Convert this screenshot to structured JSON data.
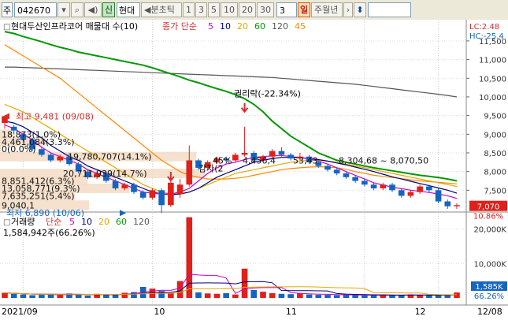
{
  "toolbar": {
    "market_label": "주",
    "code": "042670",
    "name": "현대",
    "period_prefix": "◀분초틱",
    "periods": [
      "1",
      "3",
      "5",
      "10",
      "20",
      "30"
    ],
    "selected_period": "3",
    "day_label": "일",
    "week_month_year": "주월년"
  },
  "price_panel": {
    "legend_title": "현대두산인프라코어 매물대 수(10)",
    "legend_ma_label": "종가 단순",
    "ma_periods": [
      "5",
      "10",
      "20",
      "60",
      "120",
      "45"
    ],
    "ma_colors": [
      "#cc00cc",
      "#000080",
      "#e6a700",
      "#009900",
      "#555555",
      "#ff8800"
    ],
    "lc_label": "LC:2.48",
    "hc_label": "HC:-25.4",
    "y_ticks": [
      11500,
      11000,
      10500,
      10000,
      9500,
      9000,
      8500,
      8000,
      7500
    ],
    "high_label": "최고 9,481 (09/08)",
    "low_label": "최저 6,890 (10/06)",
    "event_label_1": "권리락(-22.34%)",
    "event_label_2": "감자(2",
    "current_price": "7,070",
    "current_change": "10.86%"
  },
  "volume_profile": [
    {
      "label": "18,873(1.0%)",
      "price": 9000,
      "pct": 1.0
    },
    {
      "label": "4,461,084(3.3%)",
      "price": 8800,
      "pct": 3.3
    },
    {
      "label": "0(0.0%)",
      "price": 8600,
      "pct": 0.0
    },
    {
      "label": "19,780,707(14.1%)",
      "price": 8400,
      "pct": 14.1
    },
    {
      "label": "20,711,939(14.7%)",
      "price": 7950,
      "pct": 14.7
    },
    {
      "label": "8,851,412(6.3%)",
      "price": 7750,
      "pct": 6.3
    },
    {
      "label": "13,058,771(9.3%)",
      "price": 7550,
      "pct": 9.3
    },
    {
      "label": "7,635,251(5.4%)",
      "price": 7350,
      "pct": 5.4
    },
    {
      "label": "9,040,1",
      "price": 7100,
      "pct": 6.4
    }
  ],
  "profile_overlay_labels": [
    "45%",
    "4,456,4",
    "53,43",
    "8,304,68 ~ 8,070,50"
  ],
  "volume_panel": {
    "legend_title": "거래량",
    "legend_ma_label": "단순",
    "ma_periods": [
      "5",
      "10",
      "20",
      "60",
      "120"
    ],
    "ma_colors": [
      "#cc00cc",
      "#000080",
      "#e6a700",
      "#009900",
      "#555555"
    ],
    "max_label": "1,584,942주(66.26%)",
    "y_ticks": [
      "20,000K",
      "10,000K"
    ],
    "current_volume": "1,585K",
    "current_pct": "66.26%"
  },
  "x_axis": {
    "labels": [
      "2021/09",
      "10",
      "11",
      "12",
      "12/08"
    ]
  },
  "chart_data": {
    "type": "candlestick",
    "title": "현대두산인프라코어 매물대 수(10)",
    "y_range": [
      7000,
      11900
    ],
    "candles": [
      {
        "o": 9300,
        "c": 9481,
        "h": 9481,
        "l": 9150
      },
      {
        "o": 9200,
        "c": 9100,
        "h": 9250,
        "l": 9000
      },
      {
        "o": 9000,
        "c": 8850,
        "h": 9050,
        "l": 8800
      },
      {
        "o": 8850,
        "c": 8600,
        "h": 8900,
        "l": 8550
      },
      {
        "o": 8600,
        "c": 8450,
        "h": 8650,
        "l": 8400
      },
      {
        "o": 8450,
        "c": 8300,
        "h": 8500,
        "l": 8250
      },
      {
        "o": 8300,
        "c": 8400,
        "h": 8450,
        "l": 8250
      },
      {
        "o": 8400,
        "c": 8200,
        "h": 8450,
        "l": 8150
      },
      {
        "o": 8200,
        "c": 8000,
        "h": 8250,
        "l": 7950
      },
      {
        "o": 8000,
        "c": 7850,
        "h": 8050,
        "l": 7800
      },
      {
        "o": 7850,
        "c": 7950,
        "h": 8000,
        "l": 7800
      },
      {
        "o": 7950,
        "c": 7750,
        "h": 8000,
        "l": 7700
      },
      {
        "o": 7750,
        "c": 7550,
        "h": 7800,
        "l": 7500
      },
      {
        "o": 7550,
        "c": 7650,
        "h": 7700,
        "l": 7500
      },
      {
        "o": 7650,
        "c": 7450,
        "h": 7700,
        "l": 7400
      },
      {
        "o": 7450,
        "c": 7300,
        "h": 7500,
        "l": 7250
      },
      {
        "o": 7300,
        "c": 7500,
        "h": 7550,
        "l": 7250
      },
      {
        "o": 7500,
        "c": 7100,
        "h": 7550,
        "l": 6890
      },
      {
        "o": 7100,
        "c": 7700,
        "h": 7750,
        "l": 7050
      },
      {
        "o": 7400,
        "c": 7650,
        "h": 7800,
        "l": 7300
      },
      {
        "o": 7650,
        "c": 8300,
        "h": 8700,
        "l": 7600
      },
      {
        "o": 8300,
        "c": 8100,
        "h": 8350,
        "l": 8050
      },
      {
        "o": 8100,
        "c": 8250,
        "h": 8300,
        "l": 8050
      },
      {
        "o": 8250,
        "c": 8350,
        "h": 8400,
        "l": 8200
      },
      {
        "o": 8350,
        "c": 8300,
        "h": 8400,
        "l": 8250
      },
      {
        "o": 8300,
        "c": 8450,
        "h": 8500,
        "l": 8250
      },
      {
        "o": 8450,
        "c": 8500,
        "h": 9200,
        "l": 8400
      },
      {
        "o": 8500,
        "c": 8300,
        "h": 8550,
        "l": 8250
      },
      {
        "o": 8300,
        "c": 8400,
        "h": 8450,
        "l": 8250
      },
      {
        "o": 8400,
        "c": 8550,
        "h": 8600,
        "l": 8350
      },
      {
        "o": 8550,
        "c": 8450,
        "h": 8650,
        "l": 8400
      },
      {
        "o": 8450,
        "c": 8350,
        "h": 8500,
        "l": 8300
      },
      {
        "o": 8350,
        "c": 8400,
        "h": 8500,
        "l": 8300
      },
      {
        "o": 8400,
        "c": 8250,
        "h": 8450,
        "l": 8200
      },
      {
        "o": 8250,
        "c": 8150,
        "h": 8300,
        "l": 8100
      },
      {
        "o": 8150,
        "c": 8050,
        "h": 8200,
        "l": 8000
      },
      {
        "o": 8050,
        "c": 7950,
        "h": 8100,
        "l": 7900
      },
      {
        "o": 7950,
        "c": 7850,
        "h": 8000,
        "l": 7800
      },
      {
        "o": 7850,
        "c": 7750,
        "h": 7900,
        "l": 7700
      },
      {
        "o": 7750,
        "c": 7650,
        "h": 7800,
        "l": 7600
      },
      {
        "o": 7650,
        "c": 7550,
        "h": 7700,
        "l": 7500
      },
      {
        "o": 7550,
        "c": 7650,
        "h": 7700,
        "l": 7500
      },
      {
        "o": 7650,
        "c": 7500,
        "h": 7700,
        "l": 7450
      },
      {
        "o": 7500,
        "c": 7350,
        "h": 7550,
        "l": 7300
      },
      {
        "o": 7350,
        "c": 7450,
        "h": 7500,
        "l": 7300
      },
      {
        "o": 7450,
        "c": 7600,
        "h": 7650,
        "l": 7400
      },
      {
        "o": 7600,
        "c": 7500,
        "h": 7650,
        "l": 7450
      },
      {
        "o": 7500,
        "c": 7200,
        "h": 7550,
        "l": 7150
      },
      {
        "o": 7200,
        "c": 7070,
        "h": 7250,
        "l": 7000
      },
      {
        "o": 7070,
        "c": 7100,
        "h": 7150,
        "l": 7000
      }
    ],
    "ma_series": [
      {
        "period": "120",
        "color": "#555555",
        "values": [
          10800,
          10800,
          10790,
          10780,
          10770,
          10760,
          10750,
          10740,
          10730,
          10720,
          10710,
          10700,
          10690,
          10680,
          10670,
          10660,
          10650,
          10640,
          10630,
          10620,
          10610,
          10600,
          10590,
          10580,
          10570,
          10560,
          10550,
          10540,
          10530,
          10520,
          10500,
          10480,
          10460,
          10440,
          10420,
          10400,
          10380,
          10360,
          10340,
          10310,
          10280,
          10250,
          10220,
          10190,
          10160,
          10130,
          10100,
          10070,
          10040,
          10000
        ]
      },
      {
        "period": "60",
        "color": "#009900",
        "values": [
          11750,
          11700,
          11620,
          11550,
          11480,
          11400,
          11330,
          11270,
          11200,
          11150,
          11100,
          11050,
          11000,
          10950,
          10900,
          10850,
          10780,
          10700,
          10620,
          10540,
          10450,
          10380,
          10300,
          10220,
          10150,
          10060,
          9950,
          9800,
          9600,
          9350,
          9150,
          8950,
          8800,
          8650,
          8500,
          8400,
          8300,
          8250,
          8200,
          8150,
          8100,
          8060,
          8020,
          7980,
          7940,
          7900,
          7870,
          7840,
          7800,
          7750
        ]
      },
      {
        "period": "45",
        "color": "#ff8800",
        "values": [
          11400,
          11250,
          11100,
          10950,
          10800,
          10650,
          10500,
          10300,
          10100,
          9900,
          9700,
          9500,
          9300,
          9100,
          8900,
          8700,
          8500,
          8300,
          8150,
          8000,
          7900,
          7850,
          7800,
          7800,
          7800,
          7820,
          7850,
          7900,
          7950,
          8000,
          8050,
          8080,
          8100,
          8120,
          8130,
          8120,
          8100,
          8060,
          8000,
          7950,
          7900,
          7870,
          7840,
          7810,
          7780,
          7750,
          7730,
          7710,
          7690,
          7670
        ]
      },
      {
        "period": "20",
        "color": "#e6a700",
        "values": [
          9800,
          9700,
          9600,
          9450,
          9300,
          9150,
          9000,
          8850,
          8700,
          8550,
          8400,
          8250,
          8100,
          7950,
          7800,
          7650,
          7550,
          7450,
          7400,
          7400,
          7450,
          7550,
          7650,
          7750,
          7850,
          7950,
          8000,
          8050,
          8100,
          8150,
          8200,
          8250,
          8280,
          8300,
          8300,
          8280,
          8250,
          8200,
          8150,
          8100,
          8050,
          8000,
          7950,
          7900,
          7850,
          7800,
          7750,
          7700,
          7650,
          7600
        ]
      },
      {
        "period": "10",
        "color": "#000080",
        "values": [
          9350,
          9300,
          9200,
          9050,
          8900,
          8700,
          8550,
          8400,
          8300,
          8150,
          8050,
          7950,
          7850,
          7750,
          7650,
          7550,
          7450,
          7400,
          7380,
          7400,
          7450,
          7550,
          7700,
          7850,
          7950,
          8050,
          8150,
          8250,
          8300,
          8350,
          8380,
          8380,
          8370,
          8350,
          8320,
          8280,
          8230,
          8180,
          8120,
          8060,
          8000,
          7930,
          7860,
          7800,
          7740,
          7680,
          7620,
          7560,
          7500,
          7420
        ]
      },
      {
        "period": "5",
        "color": "#cc00cc",
        "values": [
          9250,
          9150,
          9000,
          8850,
          8650,
          8500,
          8400,
          8300,
          8200,
          8050,
          7950,
          7850,
          7750,
          7650,
          7550,
          7450,
          7420,
          7400,
          7400,
          7450,
          7550,
          7750,
          7950,
          8100,
          8200,
          8250,
          8320,
          8380,
          8400,
          8420,
          8430,
          8400,
          8380,
          8350,
          8280,
          8200,
          8100,
          8000,
          7900,
          7800,
          7700,
          7640,
          7580,
          7540,
          7500,
          7470,
          7440,
          7400,
          7350,
          7280
        ]
      }
    ],
    "volumes_k": [
      1500,
      1200,
      1000,
      800,
      900,
      1100,
      800,
      1300,
      900,
      700,
      1200,
      900,
      1000,
      1500,
      1700,
      3200,
      2700,
      2000,
      1400,
      4900,
      23400,
      1600,
      1300,
      1200,
      1400,
      1000,
      8500,
      2300,
      1800,
      1400,
      1200,
      1100,
      1300,
      1000,
      900,
      900,
      800,
      900,
      800,
      700,
      800,
      900,
      700,
      900,
      1000,
      800,
      700,
      800,
      1000,
      1585
    ],
    "volume_y_range": [
      0,
      24000
    ]
  }
}
